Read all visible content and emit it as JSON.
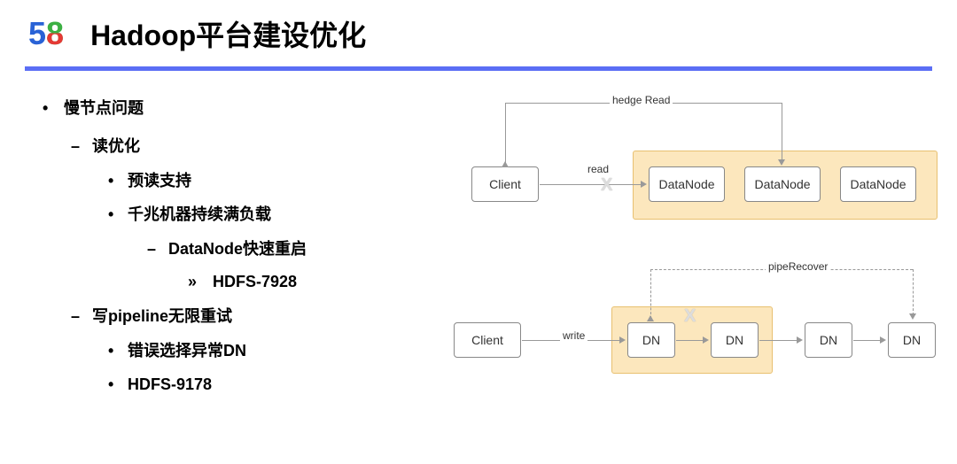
{
  "header": {
    "logo": {
      "five": "5",
      "eight": "8"
    },
    "title": "Hadoop平台建设优化"
  },
  "bullets": {
    "slow_node": "慢节点问题",
    "read_opt": "读优化",
    "preread": "预读支持",
    "gigabit": "千兆机器持续满负载",
    "dn_restart": "DataNode快速重启",
    "hdfs7928": "HDFS-7928",
    "write_pipe": "写pipeline无限重试",
    "wrong_dn": "错误选择异常DN",
    "hdfs9178": "HDFS-9178"
  },
  "diagram1": {
    "hedge_read": "hedge Read",
    "read": "read",
    "client": "Client",
    "dn1": "DataNode",
    "dn2": "DataNode",
    "dn3": "DataNode",
    "x": "X"
  },
  "diagram2": {
    "pipe_recover": "pipeRecover",
    "write": "write",
    "client": "Client",
    "dn": "DN",
    "x": "X"
  }
}
